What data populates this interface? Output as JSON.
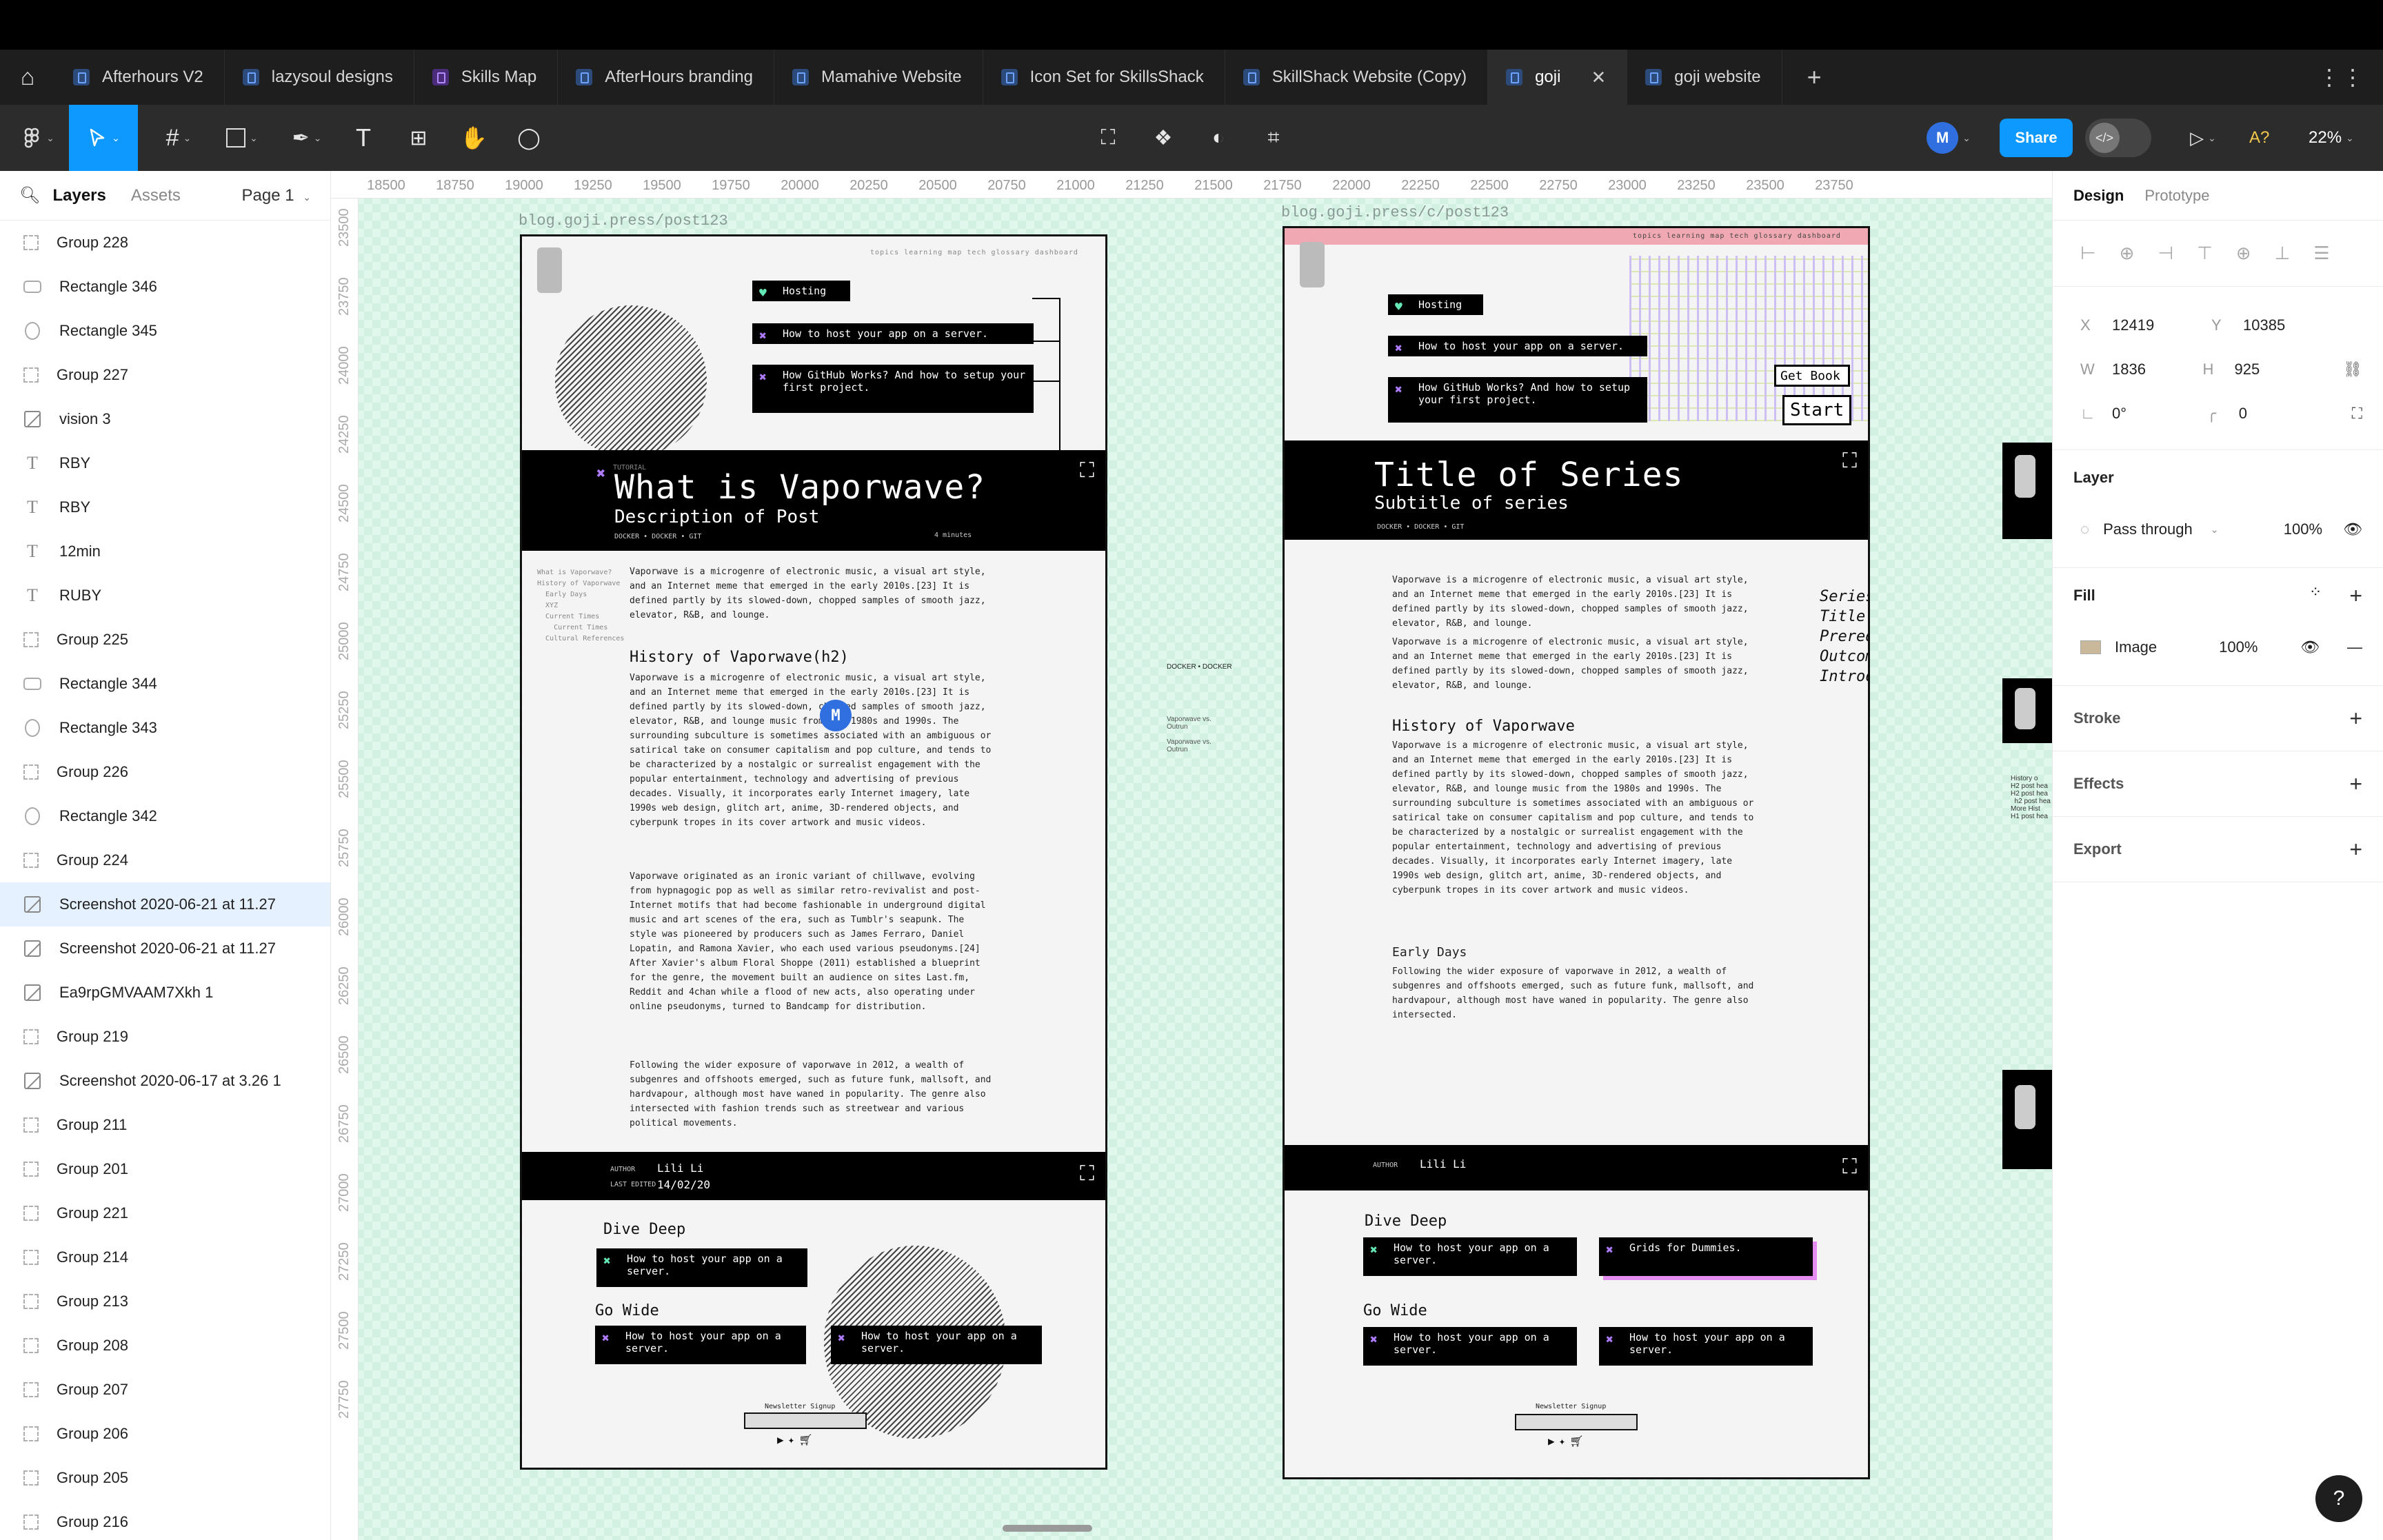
{
  "tabs": [
    {
      "label": "Afterhours V2",
      "kind": "blue"
    },
    {
      "label": "lazysoul designs",
      "kind": "blue"
    },
    {
      "label": "Skills Map",
      "kind": "purple"
    },
    {
      "label": "AfterHours branding",
      "kind": "blue"
    },
    {
      "label": "Mamahive Website",
      "kind": "blue"
    },
    {
      "label": "Icon Set for SkillsShack",
      "kind": "blue"
    },
    {
      "label": "SkillShack Website (Copy)",
      "kind": "blue"
    },
    {
      "label": "goji",
      "kind": "blue",
      "active": true
    },
    {
      "label": "goji website",
      "kind": "blue"
    }
  ],
  "toolbar": {
    "avatar": "M",
    "share": "Share",
    "zoom": "22%",
    "aa": "A?"
  },
  "left": {
    "tab_layers": "Layers",
    "tab_assets": "Assets",
    "page": "Page 1",
    "layers": [
      {
        "name": "Group 228",
        "type": "group"
      },
      {
        "name": "Rectangle 346",
        "type": "rect"
      },
      {
        "name": "Rectangle 345",
        "type": "ellipse"
      },
      {
        "name": "Group 227",
        "type": "group"
      },
      {
        "name": "vision 3",
        "type": "image"
      },
      {
        "name": "RBY",
        "type": "text"
      },
      {
        "name": "RBY",
        "type": "text"
      },
      {
        "name": "12min",
        "type": "text"
      },
      {
        "name": "RUBY",
        "type": "text"
      },
      {
        "name": "Group 225",
        "type": "group"
      },
      {
        "name": "Rectangle 344",
        "type": "rect"
      },
      {
        "name": "Rectangle 343",
        "type": "ellipse"
      },
      {
        "name": "Group 226",
        "type": "group"
      },
      {
        "name": "Rectangle 342",
        "type": "ellipse"
      },
      {
        "name": "Group 224",
        "type": "group"
      },
      {
        "name": "Screenshot 2020-06-21 at 11.27",
        "type": "image",
        "selected": true
      },
      {
        "name": "Screenshot 2020-06-21 at 11.27",
        "type": "image"
      },
      {
        "name": "Ea9rpGMVAAM7Xkh 1",
        "type": "image"
      },
      {
        "name": "Group 219",
        "type": "group"
      },
      {
        "name": "Screenshot 2020-06-17 at 3.26 1",
        "type": "image"
      },
      {
        "name": "Group 211",
        "type": "group"
      },
      {
        "name": "Group 201",
        "type": "group"
      },
      {
        "name": "Group 221",
        "type": "group"
      },
      {
        "name": "Group 214",
        "type": "group"
      },
      {
        "name": "Group 213",
        "type": "group"
      },
      {
        "name": "Group 208",
        "type": "group"
      },
      {
        "name": "Group 207",
        "type": "group"
      },
      {
        "name": "Group 206",
        "type": "group"
      },
      {
        "name": "Group 205",
        "type": "group"
      },
      {
        "name": "Group 216",
        "type": "group"
      }
    ]
  },
  "right": {
    "tab_design": "Design",
    "tab_prototype": "Prototype",
    "x_label": "X",
    "x": "12419",
    "y_label": "Y",
    "y": "10385",
    "w_label": "W",
    "w": "1836",
    "h_label": "H",
    "h": "925",
    "rotation": "0°",
    "radius": "0",
    "layer_title": "Layer",
    "blend": "Pass through",
    "opacity": "100%",
    "fill_title": "Fill",
    "fill_type": "Image",
    "fill_opacity": "100%",
    "stroke": "Stroke",
    "effects": "Effects",
    "export": "Export"
  },
  "ruler_h": [
    "18500",
    "18750",
    "19000",
    "19250",
    "19500",
    "19750",
    "20000",
    "20250",
    "20500",
    "20750",
    "21000",
    "21250",
    "21500",
    "21750",
    "22000",
    "22250",
    "22500",
    "22750",
    "23000",
    "23250",
    "23500",
    "23750"
  ],
  "ruler_v": [
    "23500",
    "23750",
    "24000",
    "24250",
    "24500",
    "24750",
    "25000",
    "25250",
    "25500",
    "25750",
    "26000",
    "26250",
    "26500",
    "26750",
    "27000",
    "27250",
    "27500",
    "27750"
  ],
  "frame1": {
    "label": "blog.goji.press/post123",
    "nav": "topics   learning map   tech glossary   dashboard",
    "card_hosting": "Hosting",
    "card_host_app": "How to host your app on a server.",
    "card_github": "How GitHub Works? And how to setup your first project.",
    "tutorial": "TUTORIAL",
    "title": "What is Vaporwave?",
    "subtitle": "Description of Post",
    "tags": "DOCKER  •  DOCKER  •  GIT",
    "minutes": "4 minutes",
    "toc": "What is Vaporwave?\nHistory of Vaporwave\n  Early Days\n  XYZ\n  Current Times\n    Current Times\n  Cultural References",
    "p1": "Vaporwave is a microgenre of electronic music, a visual art style, and an Internet meme that emerged in the early 2010s.[23] It is defined partly by its slowed-down, chopped samples of smooth jazz, elevator, R&B, and lounge.",
    "h_history": "History of Vaporwave(h2)",
    "p2": "Vaporwave is a microgenre of electronic music, a visual art style, and an Internet meme that emerged in the early 2010s.[23] It is defined partly by its slowed-down, chopped samples of smooth jazz, elevator, R&B, and lounge music from the 1980s and 1990s. The surrounding subculture is sometimes associated with an ambiguous or satirical take on consumer capitalism and pop culture, and tends to be characterized by a nostalgic or surrealist engagement with the popular entertainment, technology and advertising of previous decades. Visually, it incorporates early Internet imagery, late 1990s web design, glitch art, anime, 3D-rendered objects, and cyberpunk tropes in its cover artwork and music videos.",
    "p3": "Vaporwave originated as an ironic variant of chillwave, evolving from hypnagogic pop as well as similar retro-revivalist and post-Internet motifs that had become fashionable in underground digital music and art scenes of the era, such as Tumblr's seapunk. The style was pioneered by producers such as James Ferraro, Daniel Lopatin, and Ramona Xavier, who each used various pseudonyms.[24] After Xavier's album Floral Shoppe (2011) established a blueprint for the genre, the movement built an audience on sites Last.fm, Reddit and 4chan while a flood of new acts, also operating under online pseudonyms, turned to Bandcamp for distribution.",
    "p4": "Following the wider exposure of vaporwave in 2012, a wealth of subgenres and offshoots emerged, such as future funk, mallsoft, and hardvapour, although most have waned in popularity. The genre also intersected with fashion trends such as streetwear and various political movements.",
    "author_label": "AUTHOR",
    "author": "Lili Li",
    "edited_label": "LAST EDITED",
    "edited": "14/02/20",
    "dive": "Dive Deep",
    "wide": "Go Wide",
    "card_a": "How to host your app on a server.",
    "card_b": "How to host your app on a server.",
    "card_c": "How to host your app on a server.",
    "newsletter": "Newsletter Signup",
    "cursor_avatar": "M"
  },
  "frame2": {
    "label": "blog.goji.press/c/post123",
    "nav": "topics   learning map   tech glossary   dashboard",
    "card_hosting": "Hosting",
    "card_host_app": "How to host your app on a server.",
    "card_github": "How GitHub Works? And how to setup your first project.",
    "get_book": "Get Book",
    "start": "Start",
    "title": "Title of Series",
    "subtitle": "Subtitle of series",
    "tags": "DOCKER  •  DOCKER  •  GIT",
    "series_fields": "Series Fields\nTitle\nPrerequisites\nOutcomes/Goals\nIntroduction",
    "p1": "Vaporwave is a microgenre of electronic music, a visual art style, and an Internet meme that emerged in the early 2010s.[23] It is defined partly by its slowed-down, chopped samples of smooth jazz, elevator, R&B, and lounge.",
    "p1b": "Vaporwave is a microgenre of electronic music, a visual art style, and an Internet meme that emerged in the early 2010s.[23] It is defined partly by its slowed-down, chopped samples of smooth jazz, elevator, R&B, and lounge.",
    "h_history": "History of Vaporwave",
    "p2": "Vaporwave is a microgenre of electronic music, a visual art style, and an Internet meme that emerged in the early 2010s.[23] It is defined partly by its slowed-down, chopped samples of smooth jazz, elevator, R&B, and lounge music from the 1980s and 1990s. The surrounding subculture is sometimes associated with an ambiguous or satirical take on consumer capitalism and pop culture, and tends to be characterized by a nostalgic or surrealist engagement with the popular entertainment, technology and advertising of previous decades. Visually, it incorporates early Internet imagery, late 1990s web design, glitch art, anime, 3D-rendered objects, and cyberpunk tropes in its cover artwork and music videos.",
    "h_early": "Early Days",
    "p3": "Following the wider exposure of vaporwave in 2012, a wealth of subgenres and offshoots emerged, such as future funk, mallsoft, and hardvapour, although most have waned in popularity. The genre also intersected.",
    "author_label": "AUTHOR",
    "author": "Lili Li",
    "dive": "Dive Deep",
    "wide": "Go Wide",
    "card_a": "How to host your app on a server.",
    "card_b": "Grids for Dummies.",
    "card_c": "How to host your app on a server.",
    "card_d": "How to host your app on a server.",
    "newsletter": "Newsletter Signup"
  },
  "side_mini": {
    "tags": "DOCKER  •  DOCKER",
    "links": "Vaporwave vs.\nOutrun\n\nVaporwave vs.\nOutrun"
  },
  "offscreen_snip": "History o\nH2 post hea\nH2 post hea\n  h2 post hea\nMore Hist\nH1 post hea"
}
